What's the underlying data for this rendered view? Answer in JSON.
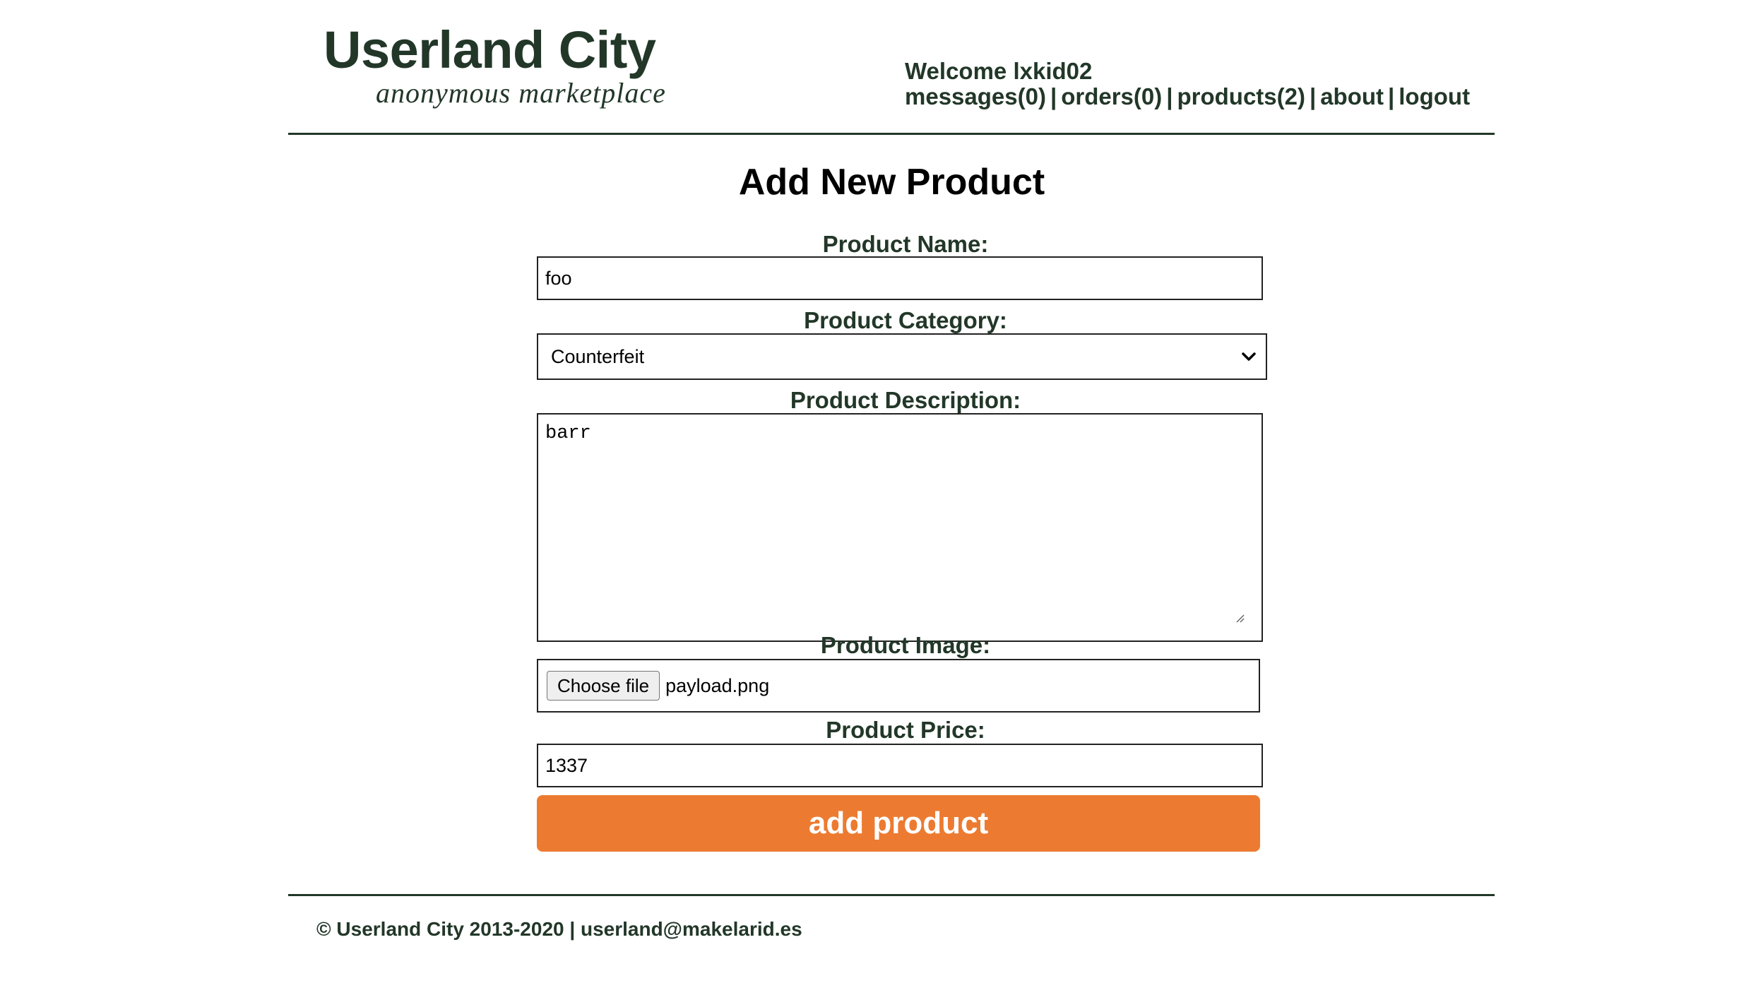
{
  "header": {
    "site_title": "Userland City",
    "site_subtitle": "anonymous  marketplace",
    "welcome": "Welcome lxkid02",
    "nav": {
      "messages": "messages(0)",
      "orders": "orders(0)",
      "products": "products(2)",
      "about": "about",
      "logout": "logout",
      "separator": "|"
    }
  },
  "form": {
    "title": "Add New Product",
    "name_label": "Product Name:",
    "name_value": "foo",
    "category_label": "Product Category:",
    "category_value": "Counterfeit",
    "description_label": "Product Description:",
    "description_value": "barr",
    "image_label": "Product Image:",
    "file_button": "Choose file",
    "file_name": "payload.png",
    "price_label": "Product Price:",
    "price_value": "1337",
    "submit_label": "add product"
  },
  "footer": {
    "text": "© Userland City 2013-2020 | userland@makelarid.es"
  },
  "colors": {
    "text_dark_green": "#223728",
    "accent_orange": "#ec7b31"
  },
  "icons": {
    "select_arrow": "chevron-down-icon",
    "textarea_grip": "resize-grip-icon"
  }
}
